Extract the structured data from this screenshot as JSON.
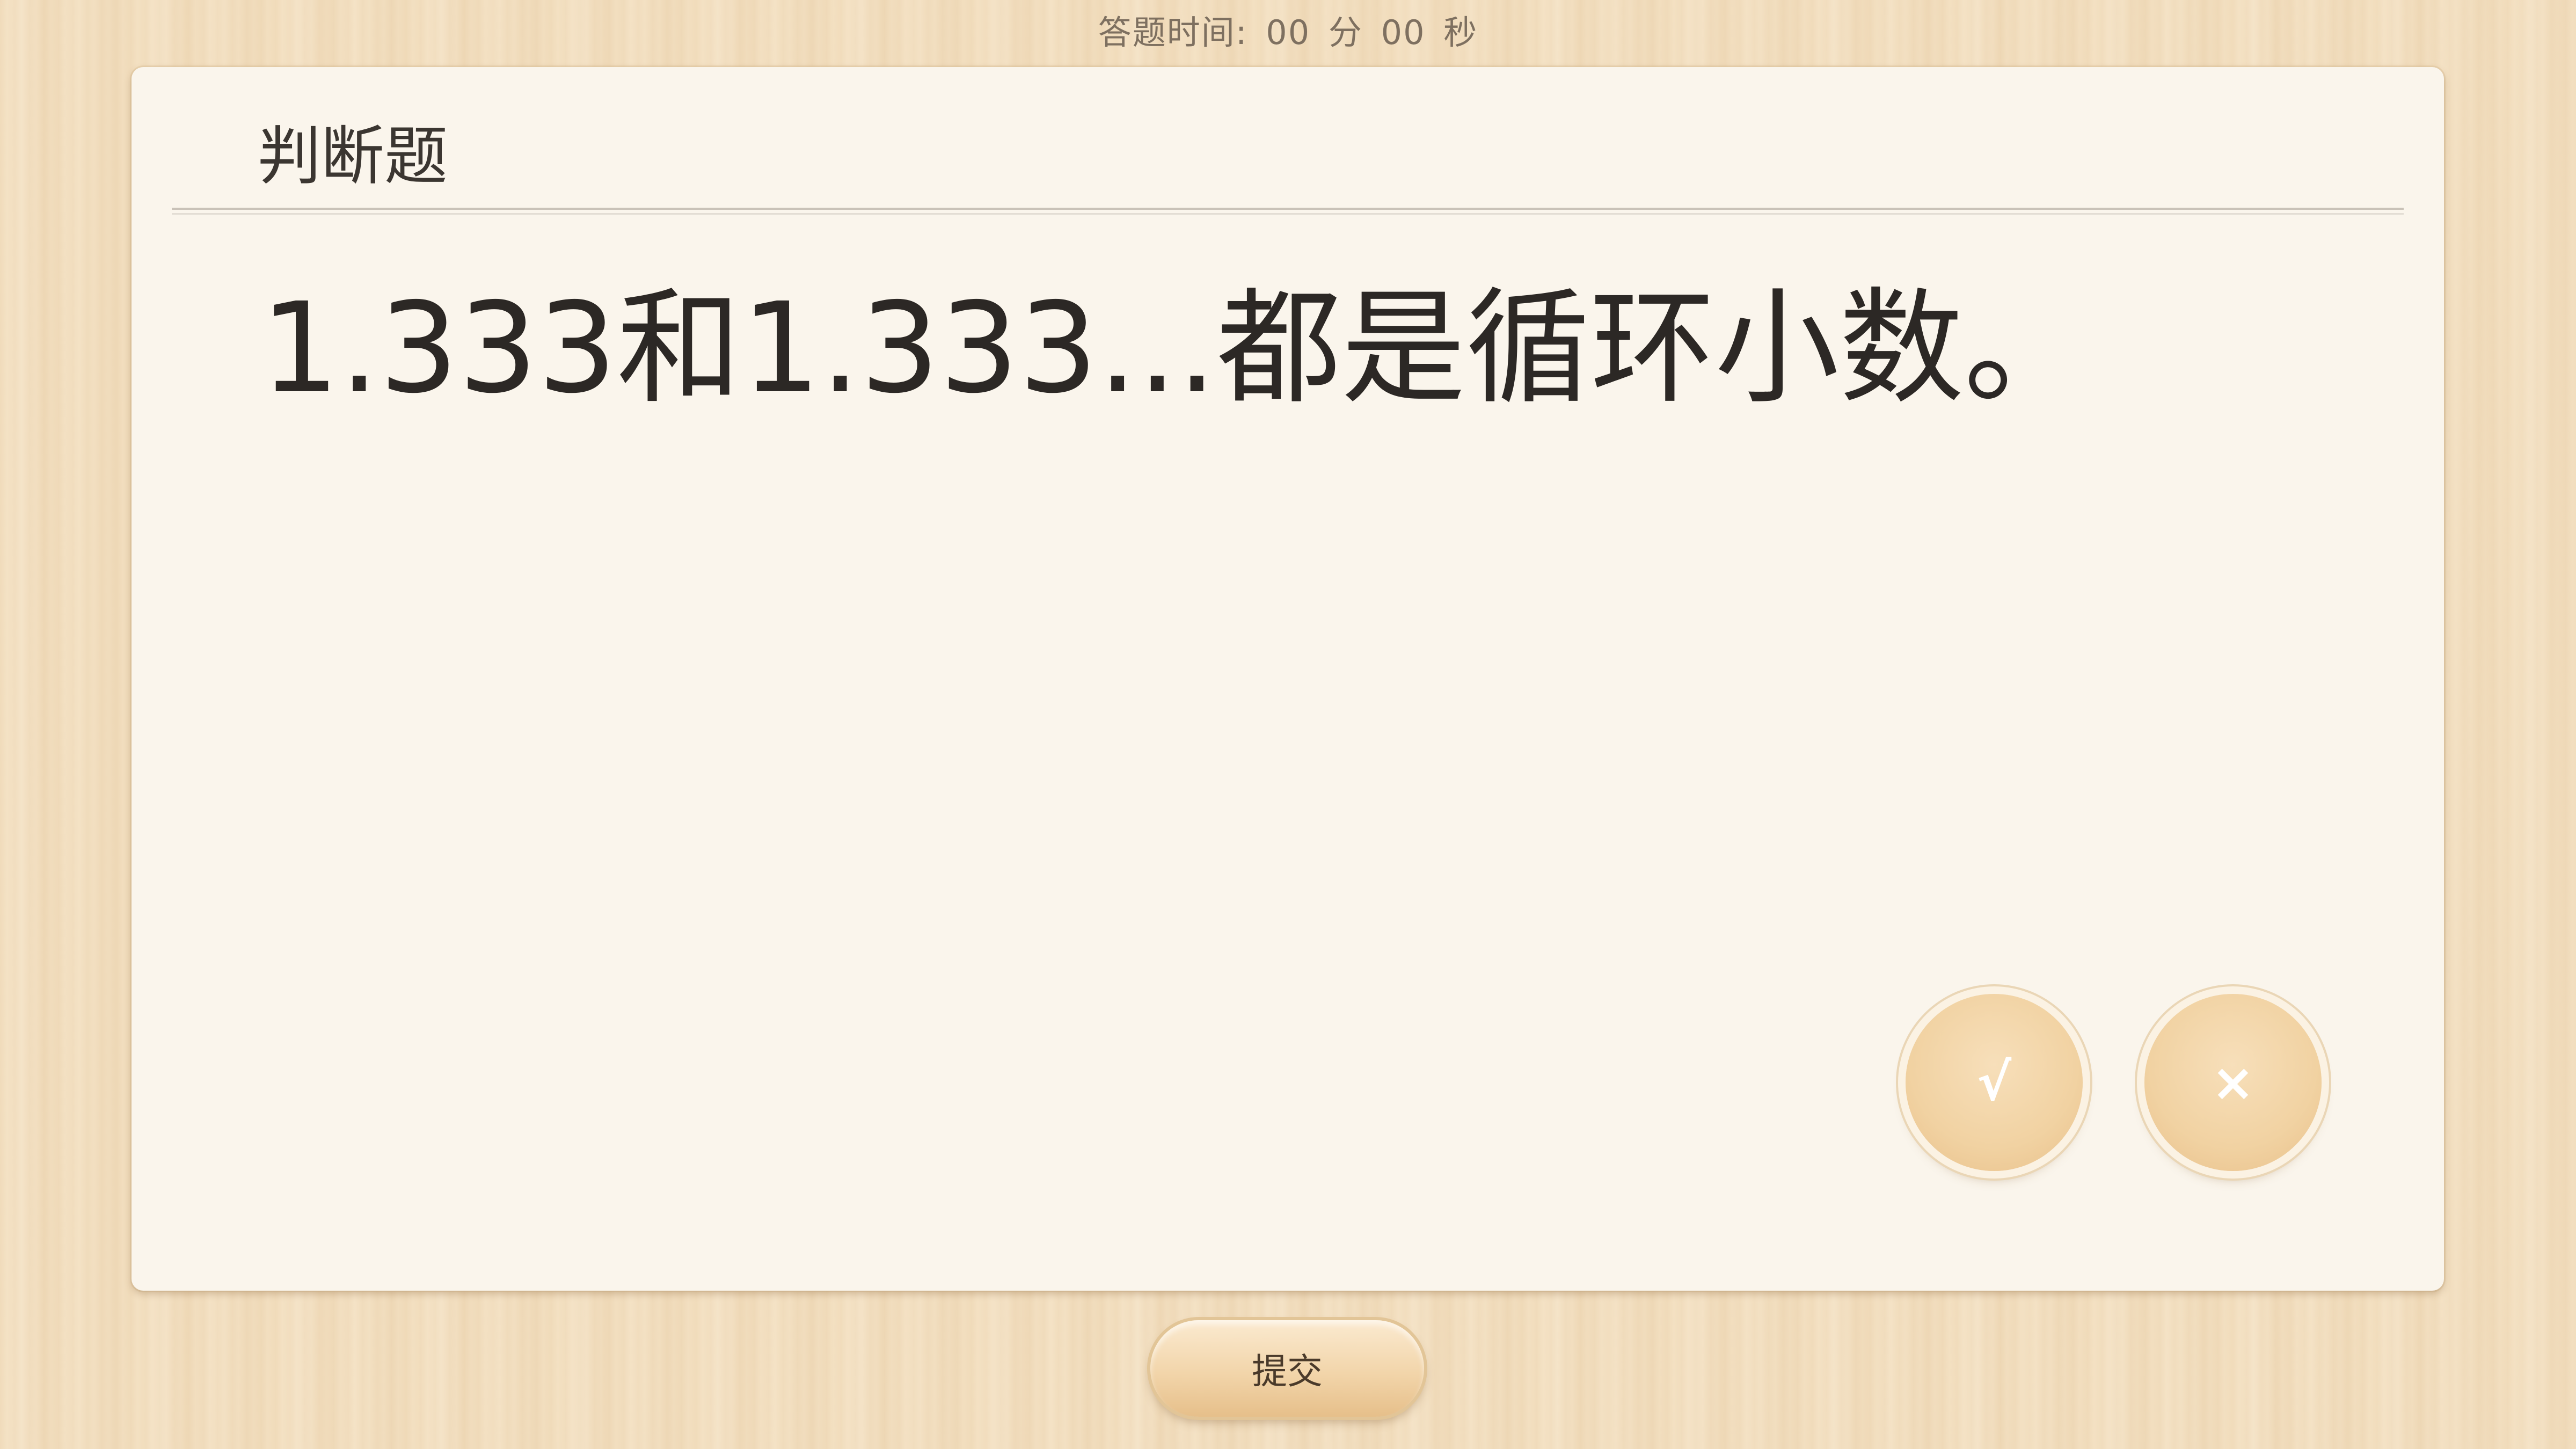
{
  "timer": {
    "label": "答题时间:",
    "minutes": "00",
    "minutes_unit": "分",
    "seconds": "00",
    "seconds_unit": "秒"
  },
  "card": {
    "question_type": "判断题",
    "question_text": "1.333和1.333...都是循环小数。"
  },
  "answers": {
    "true_label": "√",
    "false_label": "×"
  },
  "submit": {
    "label": "提交"
  },
  "colors": {
    "background": "#f3dfbf",
    "card": "#faf5ec",
    "button": "#f1d2a2"
  }
}
